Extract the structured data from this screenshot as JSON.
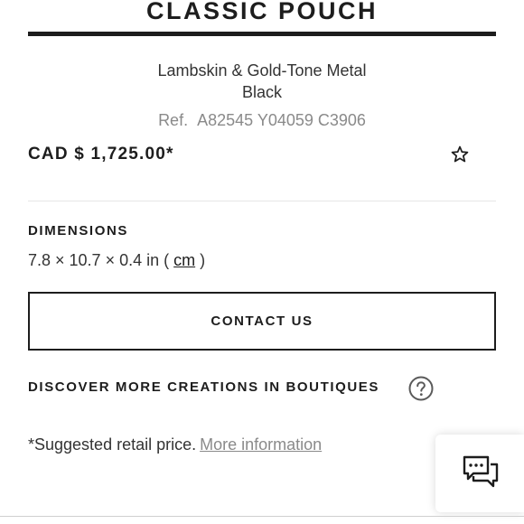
{
  "product": {
    "title": "CLASSIC POUCH",
    "material": "Lambskin & Gold-Tone Metal",
    "color": "Black",
    "ref_label": "Ref.",
    "ref_value": "A82545 Y04059 C3906",
    "price": "CAD $ 1,725.00*"
  },
  "dimensions": {
    "heading": "DIMENSIONS",
    "value_prefix": "7.8 × 10.7 × 0.4 in (",
    "unit_link": "cm",
    "value_suffix": ")"
  },
  "actions": {
    "contact_label": "CONTACT US",
    "wishlist_icon": "star-outline-icon",
    "help_icon": "question-circle-icon",
    "chat_icon": "chat-bubbles-icon"
  },
  "discover": {
    "text": "DISCOVER MORE CREATIONS IN BOUTIQUES"
  },
  "footnote": {
    "text": "*Suggested retail price.",
    "link": "More information"
  },
  "colors": {
    "text_primary": "#1d1d1d",
    "text_muted": "#8a8a8a",
    "divider": "#e6e6e6"
  }
}
